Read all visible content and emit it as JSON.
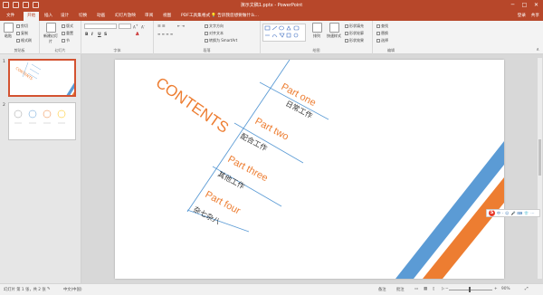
{
  "window": {
    "title": "演示文稿1.pptx - PowerPoint",
    "controls": [
      "─",
      "□",
      "✕"
    ]
  },
  "tabs": [
    "文件",
    "开始",
    "插入",
    "设计",
    "切换",
    "动画",
    "幻灯片放映",
    "审阅",
    "视图",
    "PDF工具集",
    "格式"
  ],
  "tellme": "告诉我您想要做什么...",
  "account": {
    "login": "登录",
    "share": "共享"
  },
  "ribbon": {
    "clipboard": {
      "label": "剪贴板",
      "paste": "粘贴",
      "cut": "剪切",
      "copy": "复制",
      "format_painter": "格式刷"
    },
    "slides": {
      "label": "幻灯片",
      "new_slide": "新建幻灯片",
      "layout": "版式",
      "reset": "重置",
      "section": "节"
    },
    "font": {
      "label": "字体",
      "bold": "B",
      "italic": "I",
      "underline": "U",
      "strike": "S",
      "font_color": "A"
    },
    "paragraph": {
      "label": "段落",
      "text_direction": "文字方向",
      "align_text": "对齐文本",
      "smartart": "转换为 SmartArt"
    },
    "drawing": {
      "label": "绘图",
      "arrange": "排列",
      "quick_styles": "快速样式",
      "shape_fill": "形状填充",
      "shape_outline": "形状轮廓",
      "shape_effects": "形状效果"
    },
    "editing": {
      "label": "编辑",
      "find": "查找",
      "replace": "替换",
      "select": "选择"
    }
  },
  "thumbnails": [
    {
      "number": "1",
      "selected": true
    },
    {
      "number": "2",
      "selected": false
    }
  ],
  "slide": {
    "heading": "CONTENTS",
    "items": [
      {
        "part": "Part one",
        "desc": "日常工作"
      },
      {
        "part": "Part two",
        "desc": "配合工作"
      },
      {
        "part": "Part three",
        "desc": "其他工作"
      },
      {
        "part": "Part four",
        "desc": "杂七杂八"
      }
    ],
    "colors": {
      "orange": "#ed7d31",
      "blue": "#5b9bd5",
      "line": "#5b9bd5"
    }
  },
  "floatbar": {
    "logo": "S",
    "items": [
      "中",
      "·",
      "☺",
      "🎤",
      "⌨",
      "👕",
      "⋯"
    ]
  },
  "status": {
    "slide_info": "幻灯片 第 1 张，共 2 张",
    "language": "中文(中国)",
    "notes": "备注",
    "comments": "批注",
    "zoom": "90%"
  }
}
